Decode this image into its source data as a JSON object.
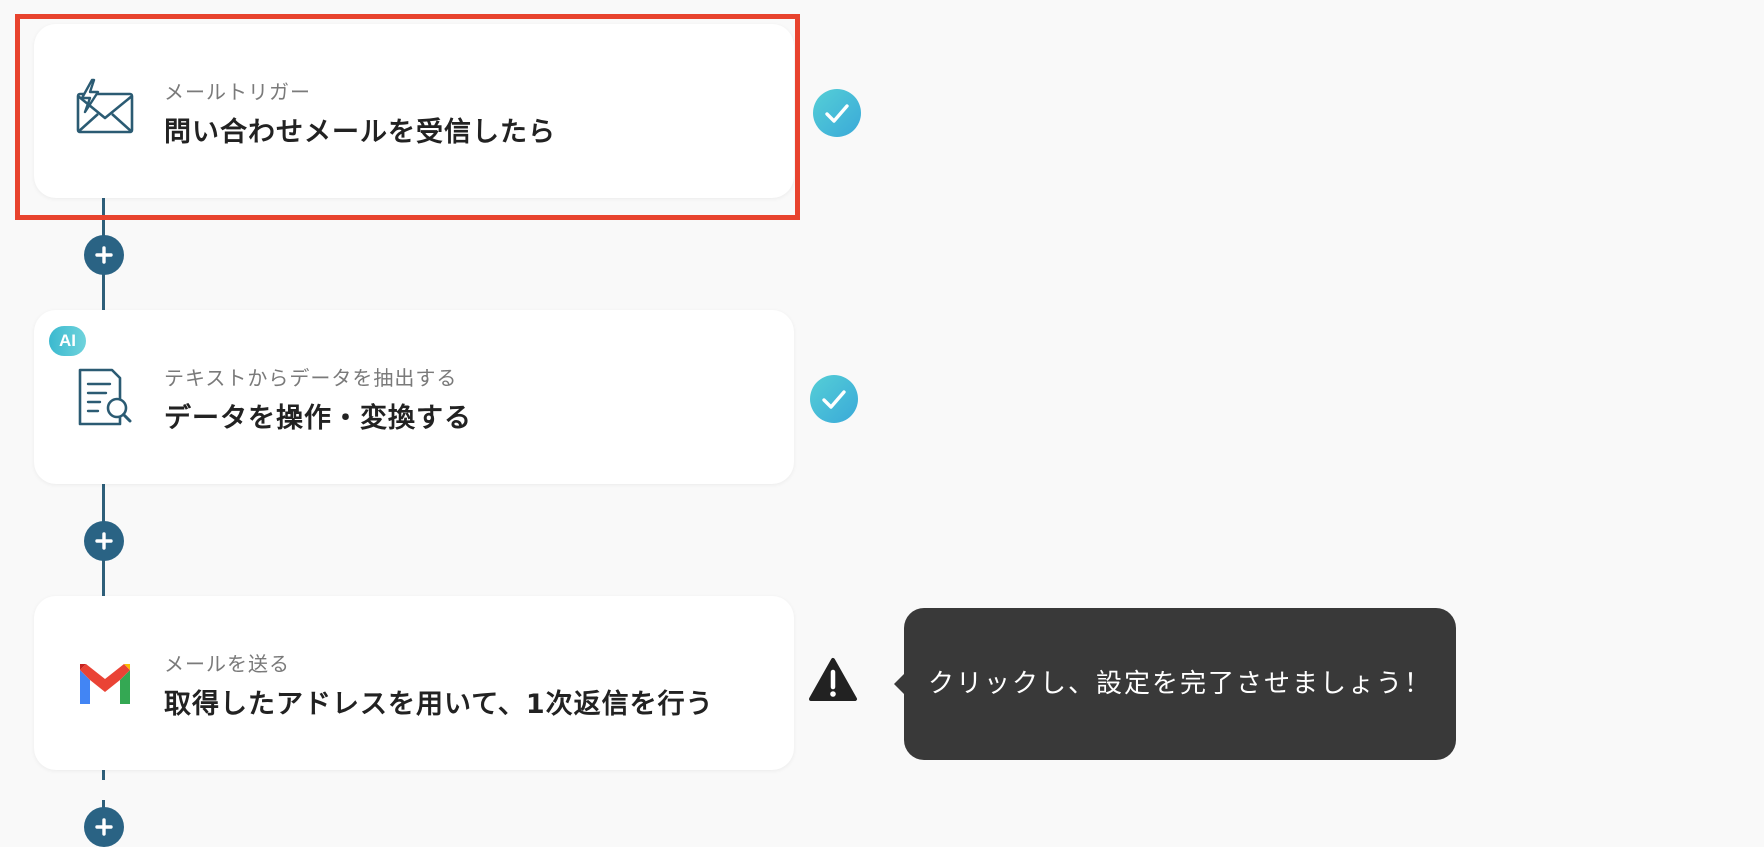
{
  "flow": {
    "steps": [
      {
        "subtitle": "メールトリガー",
        "title": "問い合わせメールを受信したら",
        "icon": "mail-trigger-icon",
        "status": "complete",
        "highlighted": true
      },
      {
        "badge": "AI",
        "subtitle": "テキストからデータを抽出する",
        "title": "データを操作・変換する",
        "icon": "document-search-icon",
        "status": "complete"
      },
      {
        "subtitle": "メールを送る",
        "title": "取得したアドレスを用いて、1次返信を行う",
        "icon": "gmail-icon",
        "status": "warning"
      }
    ],
    "tooltip": "クリックし、設定を完了させましょう！"
  },
  "colors": {
    "highlight_border": "#e8432e",
    "connector": "#2a6384",
    "check_gradient_start": "#55cfd6",
    "check_gradient_end": "#3aa9d9",
    "tooltip_bg": "#393939"
  }
}
